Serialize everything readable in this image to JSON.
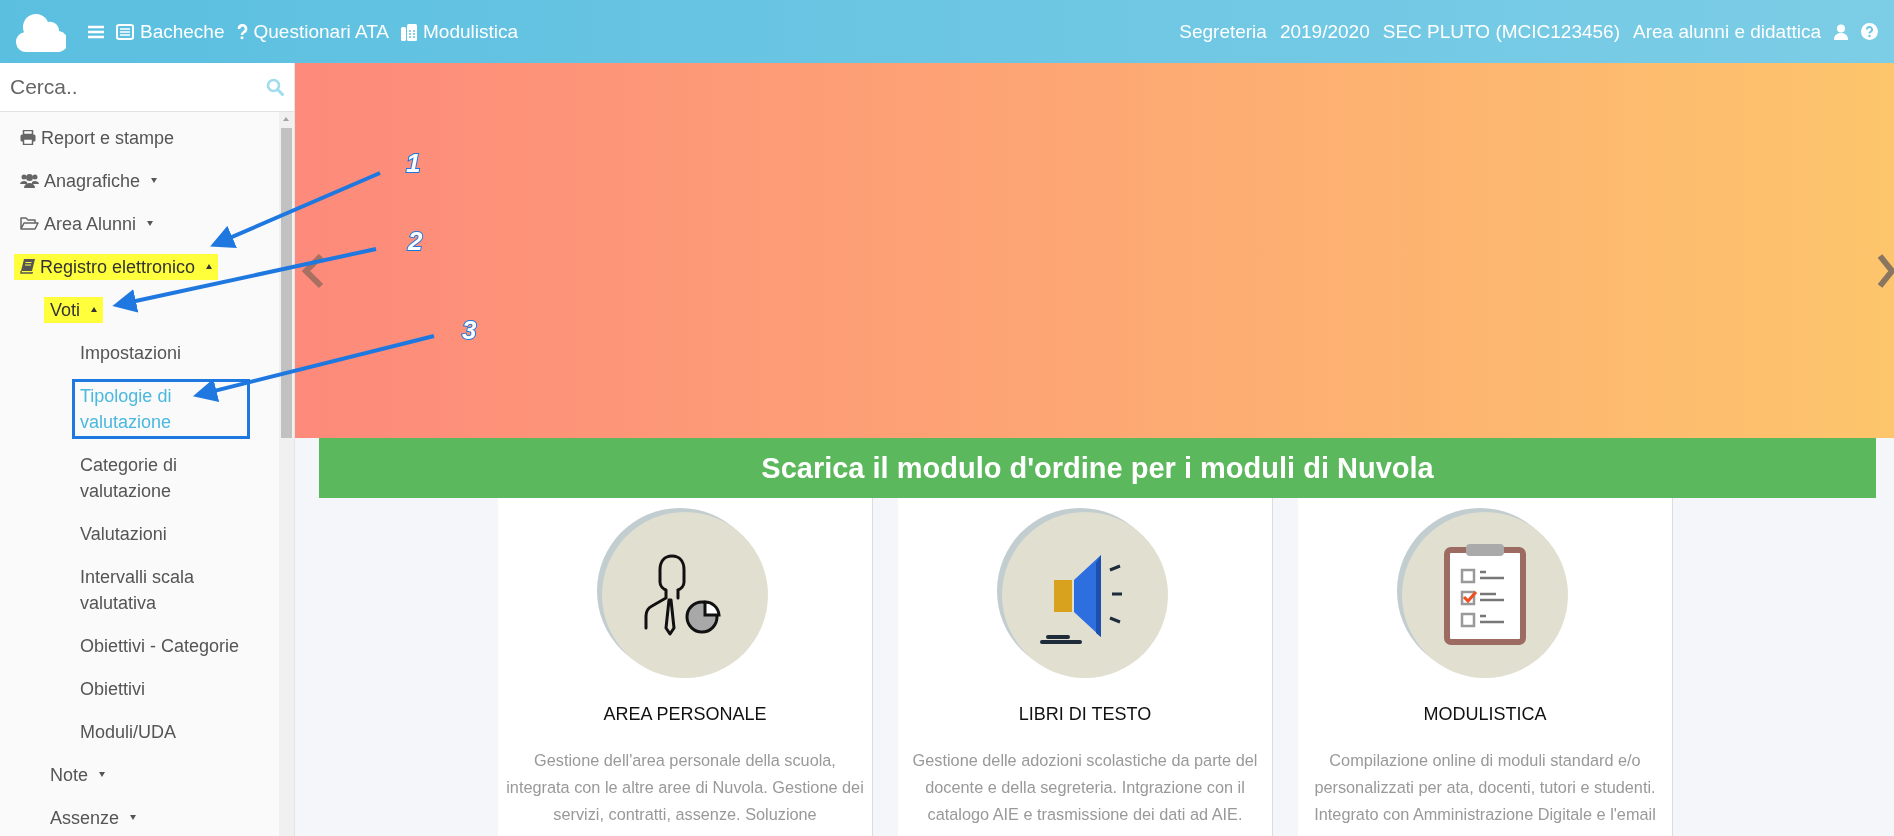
{
  "top_bar": {
    "nav": [
      "Bacheche",
      "Questionari ATA",
      "Modulistica"
    ],
    "info": [
      "Segreteria",
      "2019/2020",
      "SEC PLUTO (MCIC123456)",
      "Area alunni e didattica"
    ]
  },
  "sidebar": {
    "search": {
      "placeholder": "Cerca.."
    },
    "items": [
      {
        "label": "Report e stampe",
        "selected": false,
        "highlighted": false,
        "boxed": false
      },
      {
        "label": "Anagrafiche",
        "expanded": false,
        "selected": false,
        "highlighted": false,
        "boxed": false
      },
      {
        "label": "Area Alunni",
        "expanded": false,
        "selected": false,
        "highlighted": false,
        "boxed": false
      },
      {
        "label": "Registro elettronico",
        "expanded": true,
        "selected": false,
        "highlighted": true,
        "boxed": false,
        "children": [
          {
            "label": "Voti",
            "expanded": true,
            "selected": false,
            "highlighted": true,
            "boxed": false,
            "children": [
              {
                "label": "Impostazioni",
                "selected": false,
                "highlighted": false,
                "boxed": false
              },
              {
                "label": "Tipologie di valutazione",
                "selected": true,
                "highlighted": false,
                "boxed": true
              },
              {
                "label": "Categorie di valutazione",
                "selected": false,
                "highlighted": false,
                "boxed": false
              },
              {
                "label": "Valutazioni",
                "selected": false,
                "highlighted": false,
                "boxed": false
              },
              {
                "label": "Intervalli scala valutativa",
                "selected": false,
                "highlighted": false,
                "boxed": false
              },
              {
                "label": "Obiettivi - Categorie",
                "selected": false,
                "highlighted": false,
                "boxed": false
              },
              {
                "label": "Obiettivi",
                "selected": false,
                "highlighted": false,
                "boxed": false
              },
              {
                "label": "Moduli/UDA",
                "selected": false,
                "highlighted": false,
                "boxed": false
              }
            ]
          },
          {
            "label": "Note",
            "expanded": false,
            "selected": false,
            "highlighted": false,
            "boxed": false
          },
          {
            "label": "Assenze",
            "expanded": false,
            "selected": false,
            "highlighted": false,
            "boxed": false
          }
        ]
      }
    ]
  },
  "order_banner": {
    "text": "Scarica il modulo d'ordine per i moduli di Nuvola"
  },
  "cards": [
    {
      "title": "AREA PERSONALE",
      "description": "Gestione dell'area personale della scuola, integrata con le altre aree di Nuvola. Gestione dei servizi, contratti, assenze. Soluzione"
    },
    {
      "title": "LIBRI DI TESTO",
      "description": "Gestione delle adozioni scolastiche da parte del docente e della segreteria. Intgrazione con il catalogo AIE e trasmissione dei dati ad AIE."
    },
    {
      "title": "MODULISTICA",
      "description": "Compilazione online di moduli standard e/o personalizzati per ata, docenti, tutori e studenti. Integrato con Amministrazione Digitale e l'email"
    }
  ],
  "callouts": [
    {
      "number": "1"
    },
    {
      "number": "2"
    },
    {
      "number": "3"
    }
  ]
}
